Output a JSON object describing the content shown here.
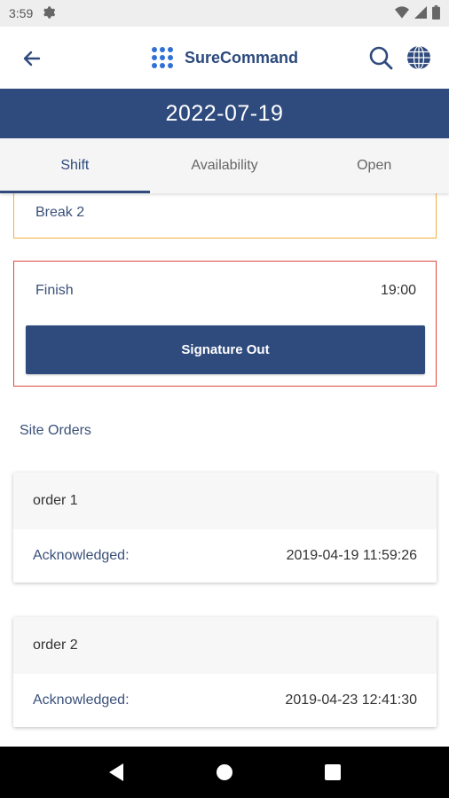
{
  "status_bar": {
    "time": "3:59"
  },
  "app_bar": {
    "title": "SureCommand"
  },
  "date_banner": {
    "date": "2022-07-19"
  },
  "tabs": [
    {
      "label": "Shift",
      "active": true
    },
    {
      "label": "Availability",
      "active": false
    },
    {
      "label": "Open",
      "active": false
    }
  ],
  "break_card": {
    "label": "Break 2"
  },
  "finish_card": {
    "label": "Finish",
    "time": "19:00",
    "button_label": "Signature Out"
  },
  "site_orders": {
    "heading": "Site Orders",
    "orders": [
      {
        "name": "order 1",
        "ack_label": "Acknowledged:",
        "ack_value": "2019-04-19 11:59:26"
      },
      {
        "name": "order 2",
        "ack_label": "Acknowledged:",
        "ack_value": "2019-04-23 12:41:30"
      }
    ]
  },
  "colors": {
    "primary": "#2f4a7d",
    "break_border": "#f0b13c",
    "finish_border": "#e0473f"
  }
}
